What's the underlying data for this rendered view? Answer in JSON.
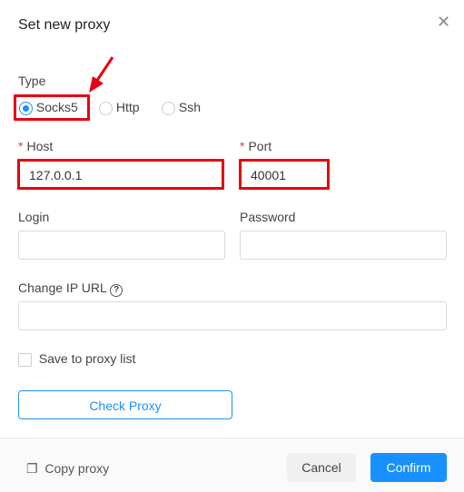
{
  "dialog": {
    "title": "Set new proxy",
    "close_icon": "close-icon"
  },
  "type": {
    "label": "Type",
    "options": [
      "Socks5",
      "Http",
      "Ssh"
    ],
    "selected": "Socks5"
  },
  "host": {
    "label": "Host",
    "value": "127.0.0.1",
    "required": true
  },
  "port": {
    "label": "Port",
    "value": "40001",
    "required": true
  },
  "login": {
    "label": "Login",
    "value": ""
  },
  "password": {
    "label": "Password",
    "value": ""
  },
  "change_ip": {
    "label": "Change IP URL",
    "value": "",
    "help_icon": "question-circle-icon"
  },
  "save": {
    "label": "Save to proxy list",
    "checked": false
  },
  "check_button": "Check Proxy",
  "footer": {
    "copy": "Copy proxy",
    "cancel": "Cancel",
    "confirm": "Confirm"
  },
  "colors": {
    "accent": "#1890ff",
    "highlight": "#e8000f"
  }
}
